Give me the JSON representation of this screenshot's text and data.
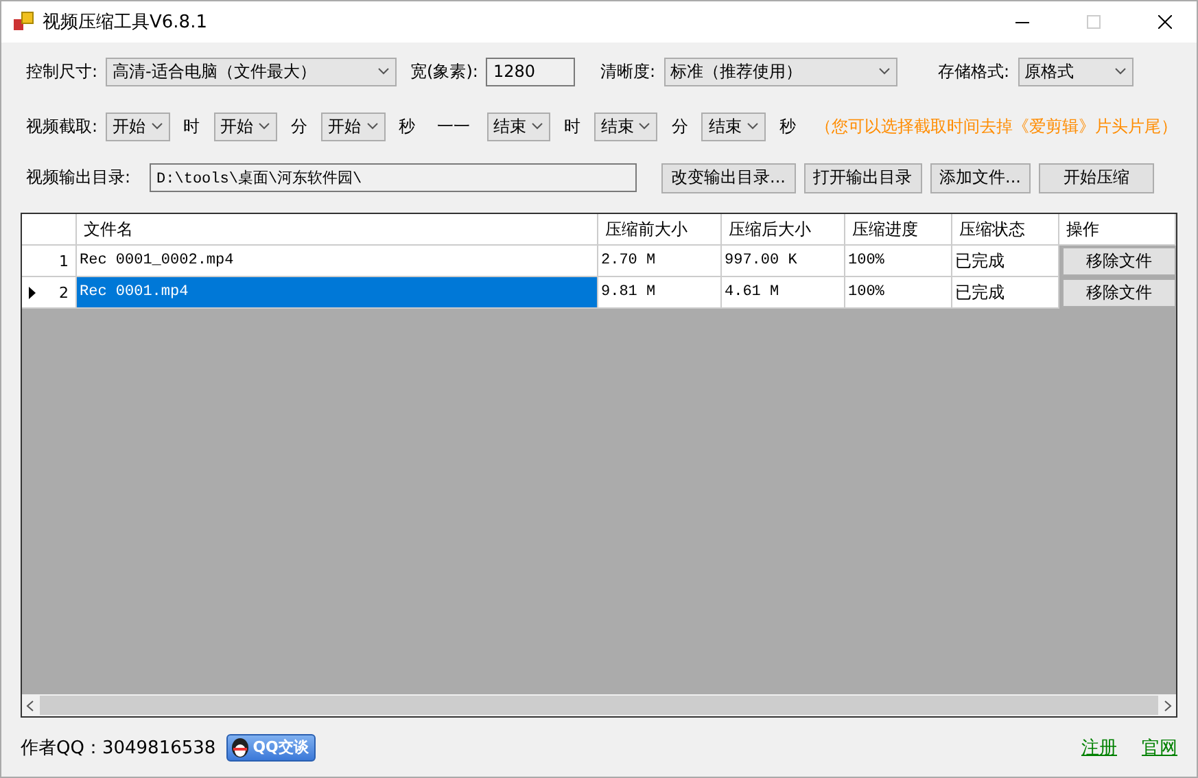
{
  "window": {
    "title": "视频压缩工具V6.8.1"
  },
  "settings": {
    "size_label": "控制尺寸:",
    "size_select": "高清-适合电脑（文件最大）",
    "width_label": "宽(象素):",
    "width_value": "1280",
    "clarity_label": "清晰度:",
    "clarity_select": "标准（推荐使用）",
    "format_label": "存储格式:",
    "format_select": "原格式"
  },
  "trim": {
    "label": "视频截取:",
    "start": [
      {
        "select": "开始",
        "unit": "时"
      },
      {
        "select": "开始",
        "unit": "分"
      },
      {
        "select": "开始",
        "unit": "秒"
      }
    ],
    "separator": "一一",
    "end": [
      {
        "select": "结束",
        "unit": "时"
      },
      {
        "select": "结束",
        "unit": "分"
      },
      {
        "select": "结束",
        "unit": "秒"
      }
    ],
    "hint": "（您可以选择截取时间去掉《爱剪辑》片头片尾）"
  },
  "output": {
    "label": "视频输出目录:",
    "path": "D:\\tools\\桌面\\河东软件园\\",
    "buttons": [
      "改变输出目录...",
      "打开输出目录",
      "添加文件...",
      "开始压缩"
    ]
  },
  "table": {
    "columns": [
      "文件名",
      "压缩前大小",
      "压缩后大小",
      "压缩进度",
      "压缩状态",
      "操作"
    ],
    "rows": [
      {
        "number": "1",
        "selected": false,
        "cells": [
          "Rec 0001_0002.mp4",
          "2.70 M",
          "997.00 K",
          "100%",
          "已完成"
        ],
        "action": "移除文件"
      },
      {
        "number": "2",
        "selected": true,
        "cells": [
          "Rec 0001.mp4",
          "9.81 M",
          "4.61 M",
          "100%",
          "已完成"
        ],
        "action": "移除文件"
      }
    ]
  },
  "footer": {
    "author": "作者QQ：3049816538",
    "qq_button": "QQ交谈",
    "links": [
      "注册",
      "官网"
    ]
  }
}
